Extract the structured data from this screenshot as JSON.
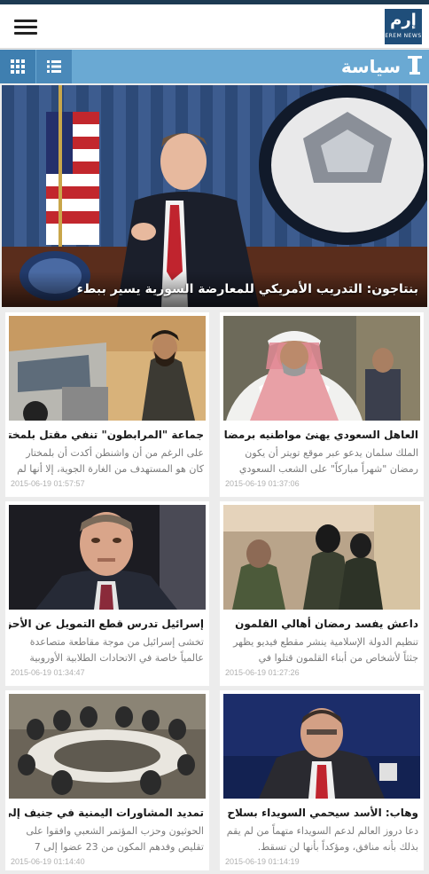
{
  "header": {
    "logo_text": "إرم",
    "logo_sub": "EREM NEWS"
  },
  "section": {
    "title": "سياسة"
  },
  "hero": {
    "caption": "بنتاجون: التدريب الأمريكي للمعارضة السورية يسير ببطء"
  },
  "cards": [
    {
      "title": "العاهل السعودي يهنئ مواطنيه برمضان",
      "excerpt": "الملك سلمان يدعو عبر موقع تويتر أن يكون رمضان \"شهراً مباركاً\" على الشعب السعودي",
      "date": "2015-06-19 01:37:06"
    },
    {
      "title": "جماعة \"المرابطون\" تنفي مقتل بلمختار",
      "excerpt": "على الرغم من أن واشنطن أكدت أن بلمختار كان هو المستهدف من الغارة الجوية، إلا أنها لم",
      "date": "2015-06-19 01:57:57"
    },
    {
      "title": "داعش يفسد رمضان أهالي القلمون",
      "excerpt": "تنظيم الدولة الإسلامية ينشر مقطع فيديو يظهر جثثاً لأشخاص من أبناء القلمون قتلوا في",
      "date": "2015-06-19 01:27:26"
    },
    {
      "title": "إسرائيل تدرس قطع التمويل عن الأحزاب",
      "excerpt": "تخشى إسرائيل من موجة مقاطعة متصاعدة عالمياً خاصة في الاتحادات الطلابية الأوروبية",
      "date": "2015-06-19 01:34:47"
    },
    {
      "title": "وهاب: الأسد سيحمي السويداء بسلاح",
      "excerpt": "دعا دروز العالم لدعم السويداء متهماً من لم يقم بذلك بأنه منافق، ومؤكداً بأنها لن تسقط.",
      "date": "2015-06-19 01:14:19"
    },
    {
      "title": "تمديد المشاورات اليمنية في جنيف إلى",
      "excerpt": "الحوثيون وحزب المؤتمر الشعبي وافقوا على تقليص وفدهم المكون من 23 عضوا إلى 7",
      "date": "2015-06-19 01:14:40"
    }
  ]
}
